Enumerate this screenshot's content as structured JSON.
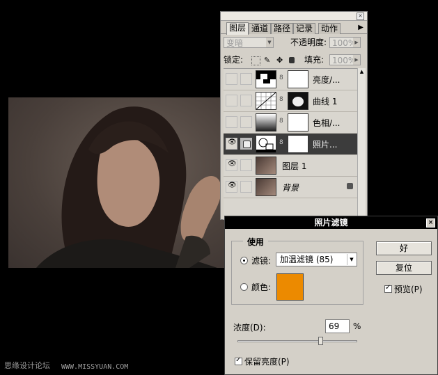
{
  "layers_panel": {
    "tabs": [
      "图层",
      "通道",
      "路径",
      "记录",
      "动作"
    ],
    "active_tab": 0,
    "blend_mode": "变暗",
    "opacity_label": "不透明度:",
    "opacity_value": "100%",
    "lock_label": "锁定:",
    "fill_label": "填充:",
    "fill_value": "100%",
    "layers": [
      {
        "name": "亮度/...",
        "kind": "adjustment",
        "visible": false,
        "selected": false
      },
      {
        "name": "曲线 1",
        "kind": "adjustment",
        "visible": false,
        "selected": false
      },
      {
        "name": "色相/...",
        "kind": "adjustment",
        "visible": false,
        "selected": false
      },
      {
        "name": "照片...",
        "kind": "adjustment",
        "visible": true,
        "selected": true
      },
      {
        "name": "图层 1",
        "kind": "photo",
        "visible": true,
        "selected": false
      },
      {
        "name": "背景",
        "kind": "photo",
        "visible": true,
        "selected": false,
        "locked": true
      }
    ]
  },
  "dialog": {
    "title": "照片滤镜",
    "group_label": "使用",
    "filter_label": "滤镜:",
    "filter_value": "加温滤镜 (85)",
    "color_label": "颜色:",
    "color_hex": "#ec8a00",
    "ok_label": "好",
    "reset_label": "复位",
    "preview_label": "预览(P)",
    "preview_checked": true,
    "density_label": "浓度(D):",
    "density_value": "69",
    "density_unit": "%",
    "density_fraction": 0.69,
    "preserve_label": "保留亮度(P)",
    "preserve_checked": true
  },
  "watermark": {
    "left": "思缘设计论坛",
    "right": "WWW.MISSYUAN.COM"
  }
}
